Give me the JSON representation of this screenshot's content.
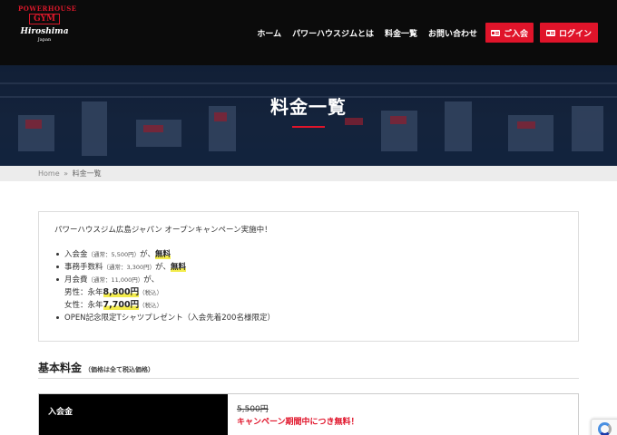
{
  "header": {
    "logo": {
      "arc_text": "POWERHOUSE",
      "gym": "GYM",
      "city": "Hiroshima",
      "country": "Japan"
    },
    "nav": [
      {
        "label": "ホーム"
      },
      {
        "label": "パワーハウスジムとは"
      },
      {
        "label": "料金一覧"
      },
      {
        "label": "お問い合わせ"
      }
    ],
    "join_button": "ご入会",
    "login_button": "ログイン",
    "accent_color": "#e0142a"
  },
  "hero": {
    "title": "料金一覧"
  },
  "breadcrumb": {
    "home": "Home",
    "separator": "»",
    "current": "料金一覧"
  },
  "campaign": {
    "lead": "パワーハウスジム広島ジャパン オープンキャンペーン実施中！",
    "items": {
      "entry_fee": {
        "label": "入会金",
        "note": "（通常：5,500円）",
        "suffix": "が、",
        "value": "無料"
      },
      "admin_fee": {
        "label": "事務手数料",
        "note": "（通常：3,300円）",
        "suffix": "が、",
        "value": "無料"
      },
      "monthly": {
        "label": "月会費",
        "note": "（通常：11,000円）",
        "suffix": "が、"
      },
      "male": {
        "label": "男性：永年",
        "value": "8,800円",
        "tax": "（税込）"
      },
      "female": {
        "label": "女性：永年",
        "value": "7,700円",
        "tax": "（税込）"
      },
      "tshirt": {
        "label": "OPEN記念限定Tシャツプレゼント（入会先着200名様限定）"
      }
    }
  },
  "section": {
    "title": "基本料金",
    "note": "（価格は全て税込価格）"
  },
  "price_table": {
    "rows": [
      {
        "label": "入会金",
        "old_price": "5,500円",
        "campaign": "キャンペーン期間中につき無料！"
      }
    ]
  }
}
